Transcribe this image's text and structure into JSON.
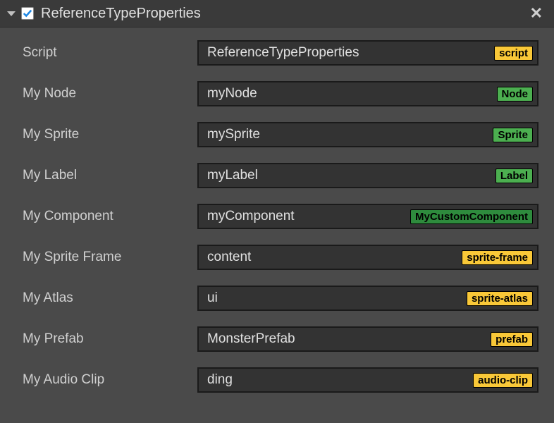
{
  "header": {
    "title": "ReferenceTypeProperties",
    "checked": true
  },
  "properties": [
    {
      "label": "Script",
      "value": "ReferenceTypeProperties",
      "badge": "script",
      "badgeStyle": "yellow"
    },
    {
      "label": "My Node",
      "value": "myNode",
      "badge": "Node",
      "badgeStyle": "green-light"
    },
    {
      "label": "My Sprite",
      "value": "mySprite",
      "badge": "Sprite",
      "badgeStyle": "green-light"
    },
    {
      "label": "My Label",
      "value": "myLabel",
      "badge": "Label",
      "badgeStyle": "green-light"
    },
    {
      "label": "My Component",
      "value": "myComponent",
      "badge": "MyCustomComponent",
      "badgeStyle": "green-dark"
    },
    {
      "label": "My Sprite Frame",
      "value": "content",
      "badge": "sprite-frame",
      "badgeStyle": "yellow"
    },
    {
      "label": "My Atlas",
      "value": "ui",
      "badge": "sprite-atlas",
      "badgeStyle": "yellow"
    },
    {
      "label": "My Prefab",
      "value": "MonsterPrefab",
      "badge": "prefab",
      "badgeStyle": "yellow"
    },
    {
      "label": "My Audio Clip",
      "value": "ding",
      "badge": "audio-clip",
      "badgeStyle": "yellow"
    }
  ]
}
